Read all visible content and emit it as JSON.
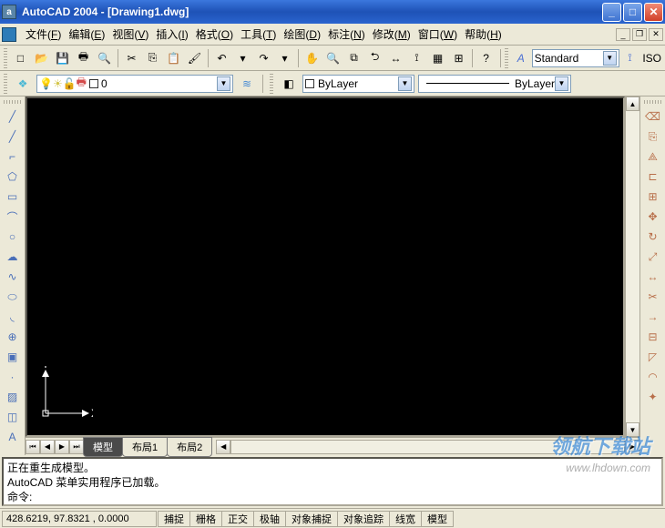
{
  "title": "AutoCAD 2004 - [Drawing1.dwg]",
  "menus": [
    "文件(F)",
    "编辑(E)",
    "视图(V)",
    "插入(I)",
    "格式(O)",
    "工具(T)",
    "绘图(D)",
    "标注(N)",
    "修改(M)",
    "窗口(W)",
    "帮助(H)"
  ],
  "standard_toolbar": [
    {
      "name": "new-icon",
      "glyph": "□"
    },
    {
      "name": "open-icon",
      "glyph": "📂"
    },
    {
      "name": "save-icon",
      "glyph": "💾"
    },
    {
      "name": "plot-icon",
      "glyph": "🖶"
    },
    {
      "name": "preview-icon",
      "glyph": "🔍"
    },
    {
      "sep": true
    },
    {
      "name": "cut-icon",
      "glyph": "✂"
    },
    {
      "name": "copy-icon",
      "glyph": "⎘"
    },
    {
      "name": "paste-icon",
      "glyph": "📋"
    },
    {
      "name": "matchprop-icon",
      "glyph": "🖌"
    },
    {
      "sep": true
    },
    {
      "name": "undo-icon",
      "glyph": "↶"
    },
    {
      "name": "undo-drop-icon",
      "glyph": "▾"
    },
    {
      "name": "redo-icon",
      "glyph": "↷"
    },
    {
      "name": "redo-drop-icon",
      "glyph": "▾"
    },
    {
      "sep": true
    },
    {
      "name": "pan-icon",
      "glyph": "✋"
    },
    {
      "name": "zoomrt-icon",
      "glyph": "🔍"
    },
    {
      "name": "zoomwin-icon",
      "glyph": "⧉"
    },
    {
      "name": "zoomprev-icon",
      "glyph": "⮌"
    },
    {
      "name": "dist-icon",
      "glyph": "↔"
    },
    {
      "name": "qdim-icon",
      "glyph": "⟟"
    },
    {
      "name": "properties-icon",
      "glyph": "▦"
    },
    {
      "name": "dc-icon",
      "glyph": "⊞"
    },
    {
      "sep": true
    },
    {
      "name": "help-icon",
      "glyph": "?"
    }
  ],
  "textstyle": {
    "label": "Standard",
    "iso": "ISO"
  },
  "layer_combo": {
    "value": "0",
    "color": "#fff"
  },
  "bylayer_color": "ByLayer",
  "bylayer_line": "ByLayer",
  "draw_tools": [
    {
      "name": "line-icon",
      "g": "╱"
    },
    {
      "name": "xline-icon",
      "g": "╱"
    },
    {
      "name": "pline-icon",
      "g": "⌐"
    },
    {
      "name": "polygon-icon",
      "g": "⬠"
    },
    {
      "name": "rectangle-icon",
      "g": "▭"
    },
    {
      "name": "arc-icon",
      "g": "⌒"
    },
    {
      "name": "circle-icon",
      "g": "○"
    },
    {
      "name": "revcloud-icon",
      "g": "☁"
    },
    {
      "name": "spline-icon",
      "g": "∿"
    },
    {
      "name": "ellipse-icon",
      "g": "⬭"
    },
    {
      "name": "ellipsearc-icon",
      "g": "◟"
    },
    {
      "name": "insert-icon",
      "g": "⊕"
    },
    {
      "name": "block-icon",
      "g": "▣"
    },
    {
      "name": "point-icon",
      "g": "·"
    },
    {
      "name": "hatch-icon",
      "g": "▨"
    },
    {
      "name": "region-icon",
      "g": "◫"
    },
    {
      "name": "mtext-icon",
      "g": "A"
    }
  ],
  "modify_tools": [
    {
      "name": "erase-icon",
      "g": "⌫"
    },
    {
      "name": "copy-obj-icon",
      "g": "⎘"
    },
    {
      "name": "mirror-icon",
      "g": "⟁"
    },
    {
      "name": "offset-icon",
      "g": "⊏"
    },
    {
      "name": "array-icon",
      "g": "⊞"
    },
    {
      "name": "move-icon",
      "g": "✥"
    },
    {
      "name": "rotate-icon",
      "g": "↻"
    },
    {
      "name": "scale-icon",
      "g": "⤢"
    },
    {
      "name": "stretch-icon",
      "g": "↔"
    },
    {
      "name": "trim-icon",
      "g": "✂"
    },
    {
      "name": "extend-icon",
      "g": "→"
    },
    {
      "name": "break-icon",
      "g": "⊟"
    },
    {
      "name": "chamfer-icon",
      "g": "◸"
    },
    {
      "name": "fillet-icon",
      "g": "◠"
    },
    {
      "name": "explode-icon",
      "g": "✦"
    }
  ],
  "ucs": {
    "x": "X",
    "y": "Y",
    "origin": "▷"
  },
  "tabs": [
    "模型",
    "布局1",
    "布局2"
  ],
  "active_tab": 0,
  "command_window": [
    "正在重生成模型。",
    "AutoCAD 菜单实用程序已加载。",
    "命令:"
  ],
  "coords": "428.6219, 97.8321 , 0.0000",
  "status_toggles": [
    "捕捉",
    "栅格",
    "正交",
    "极轴",
    "对象捕捉",
    "对象追踪",
    "线宽",
    "模型"
  ],
  "watermark": "领航下载站",
  "watermark_url": "www.lhdown.com"
}
